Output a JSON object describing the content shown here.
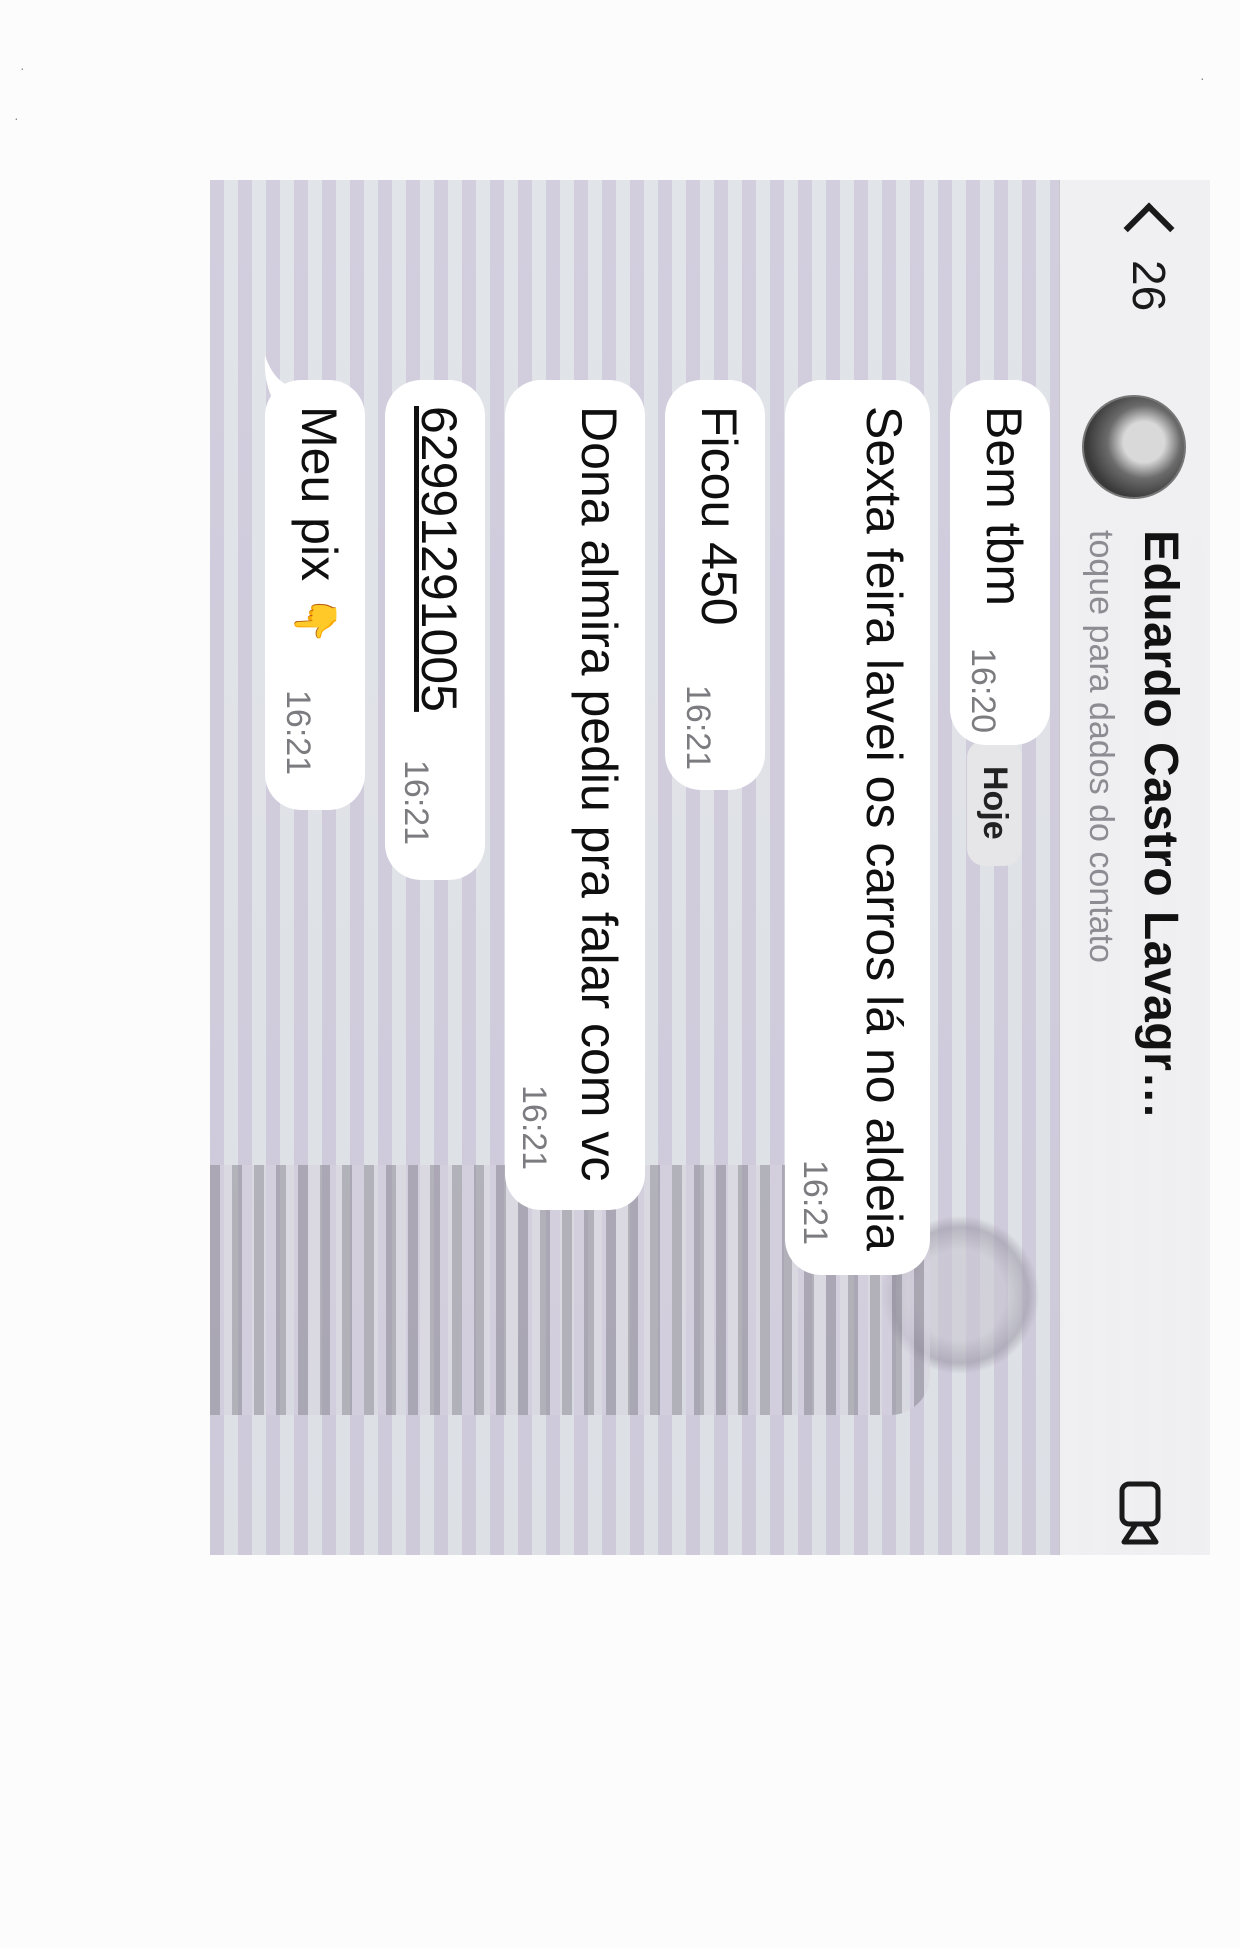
{
  "header": {
    "back_count": "26",
    "contact_name": "Eduardo Castro Lavagr…",
    "contact_subtitle": "toque para dados do contato"
  },
  "date_separator": "Hoje",
  "messages": [
    {
      "text": "Bem tbm",
      "time": "16:20"
    },
    {
      "text": "Sexta feira lavei os carros lá no aldeia",
      "time": "16:21"
    },
    {
      "text": "Ficou 450",
      "time": "16:21"
    },
    {
      "text": "Dona almira pediu pra falar com vc",
      "time": "16:21"
    },
    {
      "text": "62991291005",
      "time": "16:21"
    },
    {
      "text": "Meu pix",
      "emoji": "👇",
      "time": "16:21"
    }
  ],
  "icons": {
    "back": "chevron-left-icon",
    "video": "video-call-icon",
    "avatar": "contact-avatar"
  }
}
